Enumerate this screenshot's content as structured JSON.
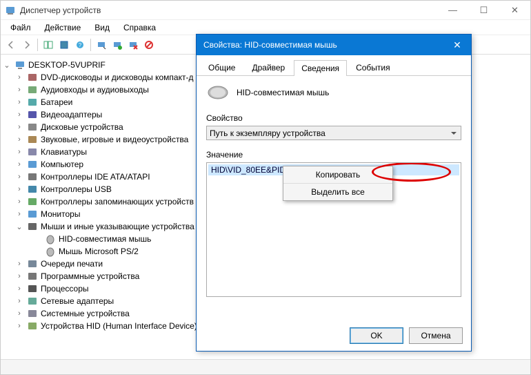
{
  "app": {
    "title": "Диспетчер устройств"
  },
  "menubar": {
    "file": "Файл",
    "action": "Действие",
    "view": "Вид",
    "help": "Справка"
  },
  "tree": {
    "root": "DESKTOP-5VUPRIF",
    "items": [
      {
        "label": "DVD-дисководы и дисководы компакт-д"
      },
      {
        "label": "Аудиовходы и аудиовыходы"
      },
      {
        "label": "Батареи"
      },
      {
        "label": "Видеоадаптеры"
      },
      {
        "label": "Дисковые устройства"
      },
      {
        "label": "Звуковые, игровые и видеоустройства"
      },
      {
        "label": "Клавиатуры"
      },
      {
        "label": "Компьютер"
      },
      {
        "label": "Контроллеры IDE ATA/ATAPI"
      },
      {
        "label": "Контроллеры USB"
      },
      {
        "label": "Контроллеры запоминающих устройств"
      },
      {
        "label": "Мониторы"
      },
      {
        "label": "Мыши и иные указывающие устройства",
        "expanded": true,
        "children": [
          {
            "label": "HID-совместимая мышь"
          },
          {
            "label": "Мышь Microsoft PS/2"
          }
        ]
      },
      {
        "label": "Очереди печати"
      },
      {
        "label": "Программные устройства"
      },
      {
        "label": "Процессоры"
      },
      {
        "label": "Сетевые адаптеры"
      },
      {
        "label": "Системные устройства"
      },
      {
        "label": "Устройства HID (Human Interface Device)"
      }
    ]
  },
  "dialog": {
    "title": "Свойства: HID-совместимая мышь",
    "tabs": {
      "general": "Общие",
      "driver": "Драйвер",
      "details": "Сведения",
      "events": "События"
    },
    "device_name": "HID-совместимая мышь",
    "property_label": "Свойство",
    "property_value": "Путь к экземпляру устройства",
    "value_label": "Значение",
    "value_text": "HID\\VID_80EE&PID_0021\\6&3E3E507&0&0000",
    "context": {
      "copy": "Копировать",
      "select_all": "Выделить все"
    },
    "ok": "OK",
    "cancel": "Отмена"
  }
}
